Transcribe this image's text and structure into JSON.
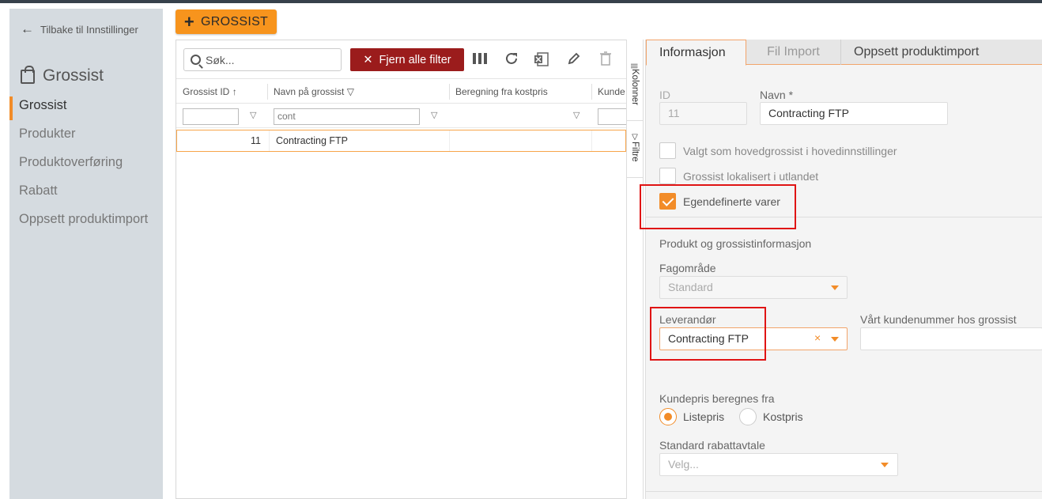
{
  "sidebar": {
    "back_label": "Tilbake til Innstillinger",
    "title": "Grossist",
    "items": [
      {
        "label": "Grossist",
        "active": true
      },
      {
        "label": "Produkter"
      },
      {
        "label": "Produktoverføring"
      },
      {
        "label": "Rabatt"
      },
      {
        "label": "Oppsett produktimport"
      }
    ]
  },
  "toolbar": {
    "add_label": "GROSSIST",
    "search_placeholder": "Søk...",
    "clear_filter_label": "Fjern alle  filter"
  },
  "grid": {
    "columns": [
      "Grossist ID",
      "Navn på grossist",
      "Beregning fra kostpris",
      "Kunde"
    ],
    "filter_values": [
      "",
      "cont",
      "",
      ""
    ],
    "rows": [
      {
        "id": "11",
        "name": "Contracting FTP",
        "calc": "",
        "kunde": ""
      }
    ]
  },
  "side_tabs": [
    "Kolonner",
    "Filtre"
  ],
  "detail": {
    "tabs": [
      "Informasjon",
      "Fil Import",
      "Oppsett produktimport"
    ],
    "id_label": "ID",
    "id_value": "11",
    "name_label": "Navn *",
    "name_value": "Contracting FTP",
    "checkboxes": [
      {
        "label": "Valgt som hovedgrossist i hovedinnstillinger",
        "checked": false
      },
      {
        "label": "Grossist lokalisert i utlandet",
        "checked": false
      },
      {
        "label": "Egendefinerte varer",
        "checked": true
      }
    ],
    "section_title": "Produkt og grossistinformasjon",
    "fagomrade_label": "Fagområde",
    "fagomrade_value": "Standard",
    "leverandor_label": "Leverandør",
    "leverandor_value": "Contracting FTP",
    "kundenummer_label": "Vårt kundenummer hos grossist",
    "kundenummer_value": "",
    "kundepris_label": "Kundepris beregnes fra",
    "radio_options": [
      {
        "label": "Listepris",
        "selected": true
      },
      {
        "label": "Kostpris",
        "selected": false
      }
    ],
    "rabatt_label": "Standard rabattavtale",
    "rabatt_placeholder": "Velg..."
  },
  "colors": {
    "accent": "#f7941d",
    "danger": "#9b1c1c",
    "highlight_box": "#e01414",
    "sidebar_bg": "#d5dbe0"
  }
}
